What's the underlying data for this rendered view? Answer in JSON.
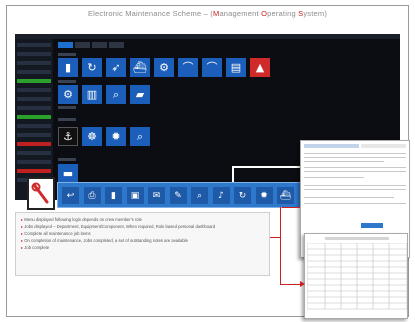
{
  "header": {
    "title_parts": [
      {
        "text": "Electronic Maintenance Scheme – (",
        "hl": false
      },
      {
        "text": "M",
        "hl": true
      },
      {
        "text": "anagement ",
        "hl": false
      },
      {
        "text": "O",
        "hl": true
      },
      {
        "text": "perating ",
        "hl": false
      },
      {
        "text": "S",
        "hl": true
      },
      {
        "text": "ystem)",
        "hl": false
      }
    ]
  },
  "colors": {
    "accent_red": "#c61f1f",
    "tile_blue": "#1c5fba",
    "app_background": "#0b0d12",
    "status_green": "#2aa12a",
    "status_red": "#c02020"
  },
  "app": {
    "sidebar_items": [
      {
        "status": "normal"
      },
      {
        "status": "normal"
      },
      {
        "status": "normal"
      },
      {
        "status": "normal"
      },
      {
        "status": "green"
      },
      {
        "status": "normal"
      },
      {
        "status": "normal"
      },
      {
        "status": "normal"
      },
      {
        "status": "green"
      },
      {
        "status": "normal"
      },
      {
        "status": "normal"
      },
      {
        "status": "red"
      },
      {
        "status": "normal"
      },
      {
        "status": "normal"
      },
      {
        "status": "red"
      },
      {
        "status": "normal"
      }
    ],
    "tabs": [
      {
        "active": true
      },
      {
        "active": false
      },
      {
        "active": false
      },
      {
        "active": false
      }
    ],
    "tile_rows": [
      [
        "document-icon",
        "refresh-icon",
        "rocket-icon",
        "ship-icon",
        "gears-icon",
        "chart-icon",
        "chart-icon",
        "report-icon",
        "warning-icon"
      ],
      [
        "gear-icon",
        "book-icon",
        "search-icon",
        "folder-icon"
      ],
      [
        "anchor-icon",
        "helm-icon",
        "settings-icon",
        "search-icon"
      ],
      [
        "file-icon"
      ]
    ]
  },
  "toolbar_icons": [
    "back-icon",
    "print-icon",
    "document-icon",
    "save-icon",
    "email-icon",
    "tools-icon",
    "search-icon",
    "bell-icon",
    "refresh-icon",
    "settings-icon",
    "ship-icon"
  ],
  "notes": [
    {
      "text": "Menu displayed following login depends on crew member’s role"
    },
    {
      "text": "Jobs displayed – Department, Equipment/Component, When required, Role based personal dashboard"
    },
    {
      "text": "Complete all maintenance job items"
    },
    {
      "text": "On completion of maintenance, Jobs completed, a set of outstanding notes are available"
    },
    {
      "text": "Job complete"
    }
  ]
}
